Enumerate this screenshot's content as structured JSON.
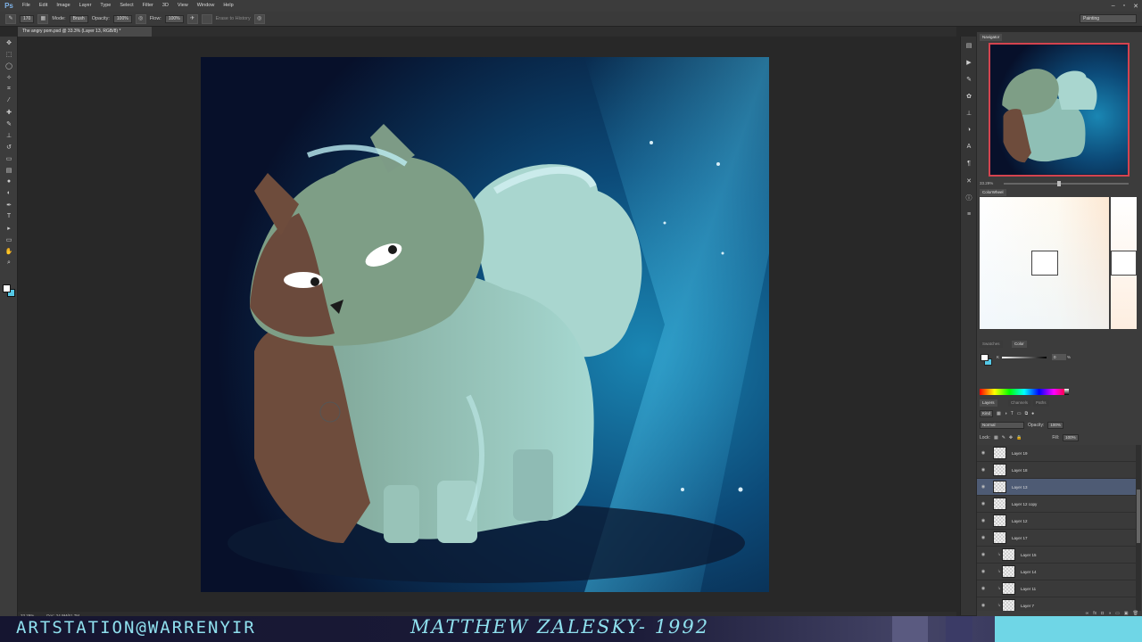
{
  "app": {
    "logo": "Ps"
  },
  "menu": [
    "File",
    "Edit",
    "Image",
    "Layer",
    "Type",
    "Select",
    "Filter",
    "3D",
    "View",
    "Window",
    "Help"
  ],
  "window_controls": [
    "–",
    "▫",
    "✕"
  ],
  "options_bar": {
    "brush_size": "170",
    "mode_label": "Mode:",
    "mode_value": "Brush",
    "opacity_label": "Opacity:",
    "opacity_value": "100%",
    "flow_label": "Flow:",
    "flow_value": "100%",
    "erase_history_label": "Erase to History",
    "workspace": "Painting"
  },
  "document_tab": "The angry pom.psd @ 33.3% (Layer 13, RGB/8) *",
  "status": {
    "zoom": "33.29%",
    "doc": "Doc: 24.9M/61.7M"
  },
  "navigator": {
    "tab": "Navigator",
    "zoom": "33.29%"
  },
  "colorwheel": {
    "tab": "ColorWheel"
  },
  "color_panel": {
    "tabs": [
      "Swatches",
      "Color"
    ],
    "k_label": "K",
    "k_value": "0",
    "k_unit": "%"
  },
  "layers_panel": {
    "tabs": [
      "Layers",
      "Channels",
      "Paths"
    ],
    "filter_kind": "Kind",
    "blend_mode": "Normal",
    "opacity_label": "Opacity:",
    "opacity_value": "100%",
    "lock_label": "Lock:",
    "fill_label": "Fill:",
    "fill_value": "100%",
    "layers": [
      {
        "name": "Layer 19",
        "selected": false,
        "clipped": false
      },
      {
        "name": "Layer 18",
        "selected": false,
        "clipped": false
      },
      {
        "name": "Layer 13",
        "selected": true,
        "clipped": false
      },
      {
        "name": "Layer 12 copy",
        "selected": false,
        "clipped": false
      },
      {
        "name": "Layer 12",
        "selected": false,
        "clipped": false
      },
      {
        "name": "Layer 17",
        "selected": false,
        "clipped": false
      },
      {
        "name": "Layer 15",
        "selected": false,
        "clipped": true
      },
      {
        "name": "Layer 14",
        "selected": false,
        "clipped": true
      },
      {
        "name": "Layer 11",
        "selected": false,
        "clipped": true
      },
      {
        "name": "Layer 7",
        "selected": false,
        "clipped": true
      }
    ]
  },
  "banner": {
    "left_text": "ARTSTATION@WARRENYIR",
    "center_text": "MATTHEW ZALESKY- 1992",
    "color": "#8fe0ee"
  },
  "colors": {
    "foreground": "#ffffff",
    "background": "#55c8e6",
    "selection": "#4e5b74",
    "nav_border": "#d4434f"
  }
}
